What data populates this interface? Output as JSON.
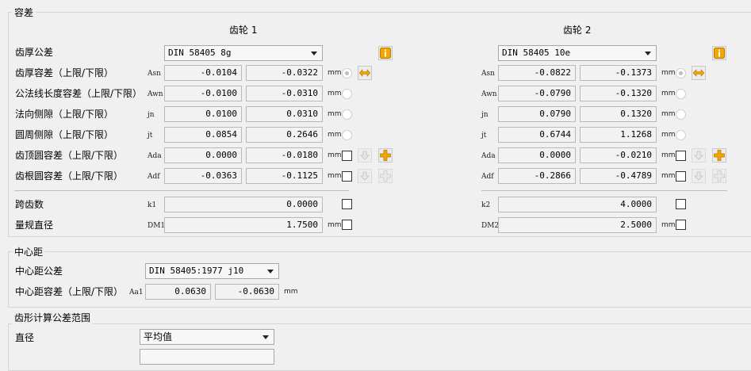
{
  "tolerance_group": {
    "title": "容差",
    "gear1_header": "齿轮 1",
    "gear2_header": "齿轮 2",
    "rows": [
      {
        "label": "齿厚公差"
      },
      {
        "label": "齿厚容差（上限/下限）",
        "sym1": "Asn",
        "sym2": "Asn",
        "g1": [
          "-0.0104",
          "-0.0322"
        ],
        "g2": [
          "-0.0822",
          "-0.1373"
        ],
        "unit": "mm"
      },
      {
        "label": "公法线长度容差（上限/下限）",
        "sym1": "Awn",
        "sym2": "Awn",
        "g1": [
          "-0.0100",
          "-0.0310"
        ],
        "g2": [
          "-0.0790",
          "-0.1320"
        ],
        "unit": "mm"
      },
      {
        "label": "法向侧隙（上限/下限）",
        "sym1": "jn",
        "sym2": "jn",
        "g1": [
          "0.0100",
          "0.0310"
        ],
        "g2": [
          "0.0790",
          "0.1320"
        ],
        "unit": "mm"
      },
      {
        "label": "圆周侧隙（上限/下限）",
        "sym1": "jt",
        "sym2": "jt",
        "g1": [
          "0.0854",
          "0.2646"
        ],
        "g2": [
          "0.6744",
          "1.1268"
        ],
        "unit": "mm"
      },
      {
        "label": "齿顶圆容差（上限/下限）",
        "sym1": "Ada",
        "sym2": "Ada",
        "g1": [
          "0.0000",
          "-0.0180"
        ],
        "g2": [
          "0.0000",
          "-0.0210"
        ],
        "unit": "mm"
      },
      {
        "label": "齿根圆容差（上限/下限）",
        "sym1": "Adf",
        "sym2": "Adf",
        "g1": [
          "-0.0363",
          "-0.1125"
        ],
        "g2": [
          "-0.2866",
          "-0.4789"
        ],
        "unit": "mm"
      }
    ],
    "gear1_tolerance": "DIN 58405 8g",
    "gear2_tolerance": "DIN 58405 10e",
    "span_label": "跨齿数",
    "span_sym1": "k1",
    "span_sym2": "k2",
    "span_g1": "0.0000",
    "span_g2": "4.0000",
    "ball_label": "量规直径",
    "ball_sym1": "DM1",
    "ball_sym2": "DM2",
    "ball_g1": "1.7500",
    "ball_g2": "2.5000",
    "unit": "mm"
  },
  "center_group": {
    "title": "中心距",
    "tol_label": "中心距公差",
    "tol_value": "DIN 58405:1977 j10",
    "dev_label": "中心距容差（上限/下限）",
    "dev_sym": "Aa1",
    "dev_upper": "0.0630",
    "dev_lower": "-0.0630",
    "unit": "mm"
  },
  "profile_group": {
    "title": "齿形计算公差范围",
    "diameter_label": "直径",
    "diameter_value": "平均值"
  },
  "colors": {
    "info_icon": "#f0a000",
    "plus_icon": "#f0a000",
    "arrow_icon": "#f0a000"
  }
}
